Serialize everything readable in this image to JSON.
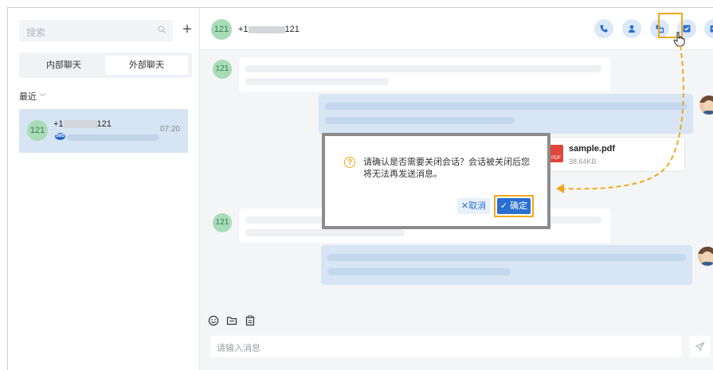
{
  "sidebar": {
    "search_placeholder": "搜索",
    "add_symbol": "+",
    "tabs": [
      {
        "label": "内部聊天"
      },
      {
        "label": "外部聊天"
      }
    ],
    "recent_label": "最近",
    "conversation": {
      "avatar": "121",
      "number_prefix": "+1",
      "number_suffix": "121",
      "time": "07:20",
      "channel_badge": "SMS"
    }
  },
  "header": {
    "avatar": "121",
    "number_prefix": "+1",
    "number_suffix": "121",
    "actions": [
      "phone-icon",
      "contact-icon",
      "transfer-icon",
      "close-session-icon",
      "archive-icon"
    ]
  },
  "messages": {
    "incoming_avatar": "121",
    "file_name": "sample.pdf",
    "file_size": "38.64KB",
    "file_type": "PDF"
  },
  "dialog": {
    "message": "请确认是否需要关闭会话？会话被关闭后您将无法再发送消息。",
    "cancel_label": "取消",
    "ok_label": "确定",
    "cancel_glyph": "✕",
    "ok_glyph": "✓"
  },
  "composer": {
    "placeholder": "请输入消息",
    "tools": [
      "emoji-icon",
      "file-icon",
      "template-icon"
    ]
  },
  "colors": {
    "accent": "#2a6fd0",
    "highlight": "#f0a81c",
    "avatar_bg": "#a8dcb7",
    "selected_bg": "#d6e4f4"
  }
}
